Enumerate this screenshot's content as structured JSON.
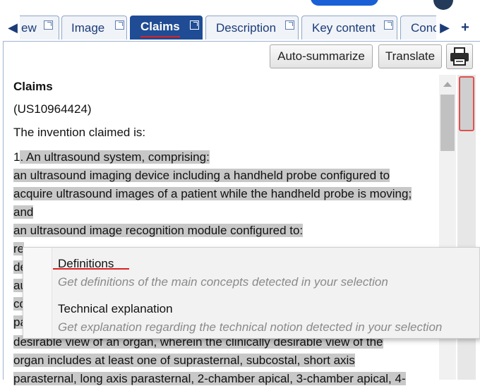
{
  "tabs": [
    {
      "label": "ew"
    },
    {
      "label": "Image"
    },
    {
      "label": "Claims",
      "active": true
    },
    {
      "label": "Description"
    },
    {
      "label": "Key content"
    },
    {
      "label": "Conc"
    }
  ],
  "toolbar": {
    "auto_summarize": "Auto-summarize",
    "translate": "Translate"
  },
  "document": {
    "heading": "Claims",
    "patent_number": "(US10964424)",
    "intro": "The invention claimed is:",
    "claim_lines": [
      "1. An ultrasound system, comprising:",
      "an ultrasound imaging device including a handheld probe configured to",
      "acquire ultrasound images of a patient while the handheld probe is moving;",
      "and",
      "an ultrasound image recognition module configured to:",
      "re",
      "de",
      "au",
      "co",
      "pa",
      "desirable view of an organ, wherein the clinically desirable view of the",
      "organ includes at least one of suprasternal, subcostal, short axis",
      "parasternal, long axis parasternal, 2-chamber apical, 3-chamber apical, 4-"
    ]
  },
  "context_menu": {
    "items": [
      {
        "title": "Definitions",
        "description": "Get definitions of the main concepts detected in your selection"
      },
      {
        "title": "Technical explanation",
        "description": "Get explanation regarding the technical notion detected in your selection"
      }
    ]
  },
  "colors": {
    "tab_active_bg": "#1f4c94",
    "tab_text": "#1b3c78",
    "selection_bg": "#c8c8c8",
    "underline_red": "#e02020"
  }
}
